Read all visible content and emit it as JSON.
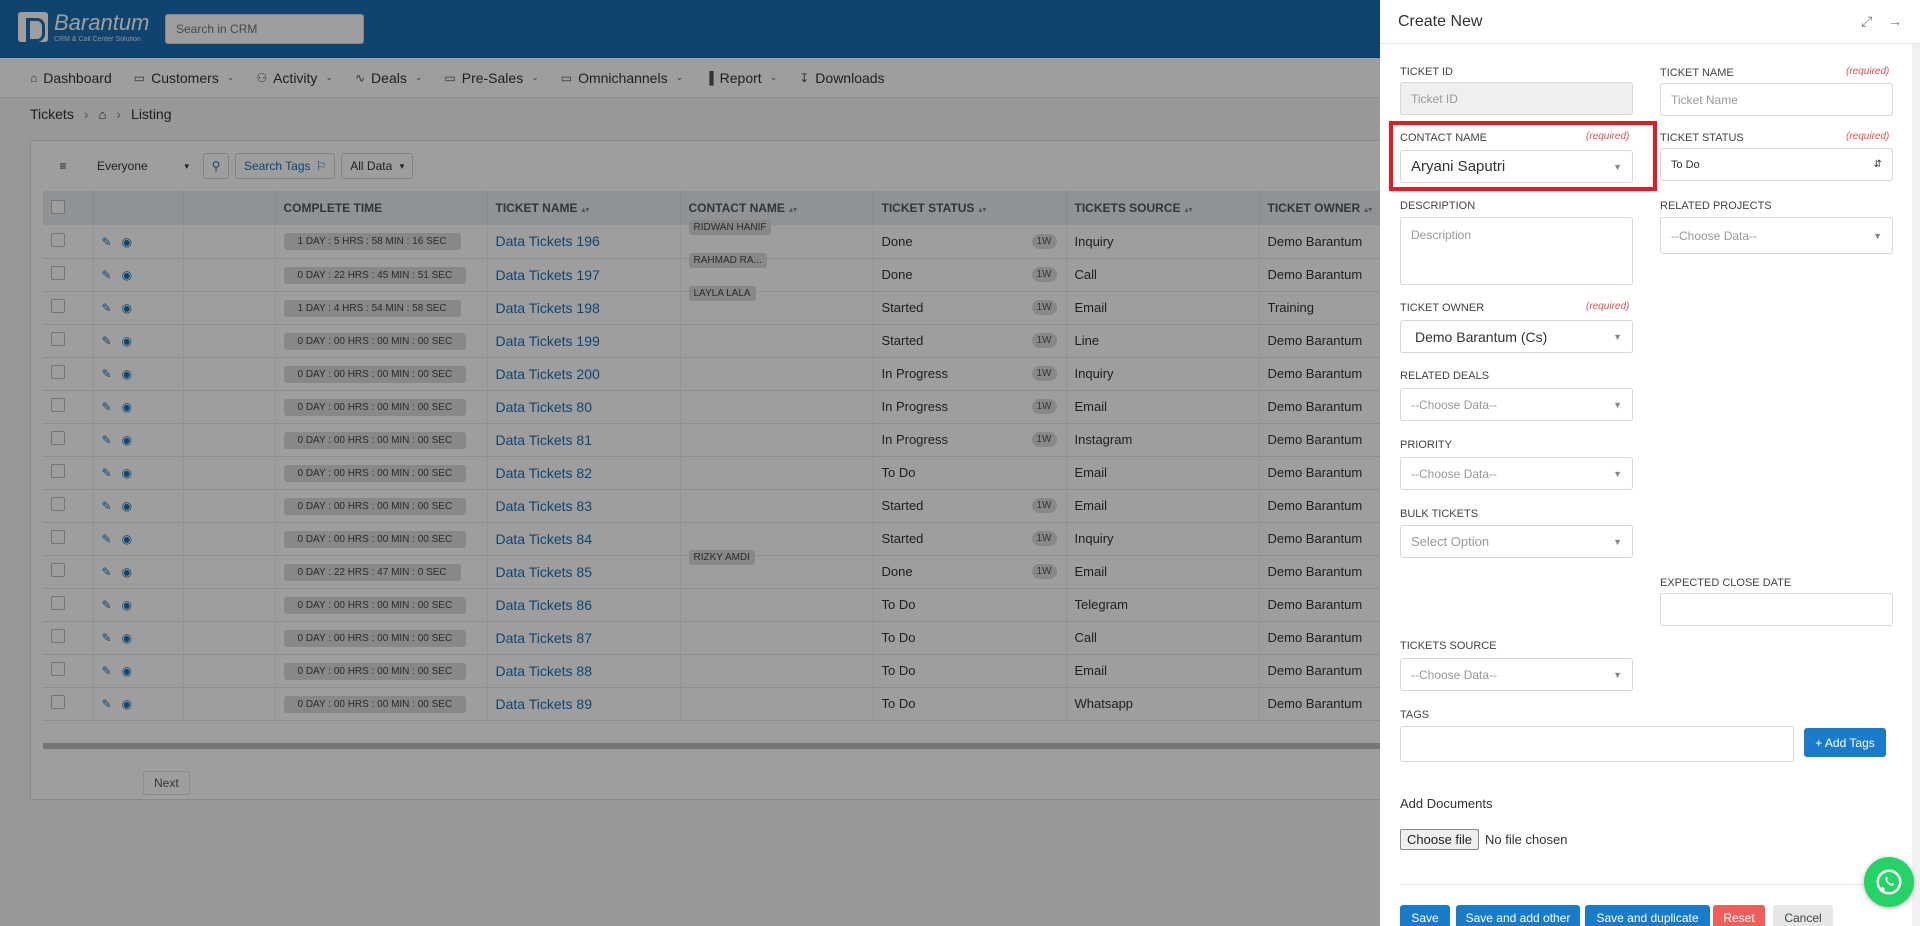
{
  "app": {
    "logo_name": "Barantum",
    "logo_sub": "CRM & Call Center Solution",
    "search_placeholder": "Search in CRM"
  },
  "nav": [
    {
      "label": "Dashboard",
      "icon": "home-icon",
      "chev": false
    },
    {
      "label": "Customers",
      "icon": "folder-icon",
      "chev": true
    },
    {
      "label": "Activity",
      "icon": "users-icon",
      "chev": true
    },
    {
      "label": "Deals",
      "icon": "pulse-icon",
      "chev": true
    },
    {
      "label": "Pre-Sales",
      "icon": "folder-icon",
      "chev": true
    },
    {
      "label": "Omnichannels",
      "icon": "folder-icon",
      "chev": true
    },
    {
      "label": "Report",
      "icon": "bar-chart-icon",
      "chev": true
    },
    {
      "label": "Downloads",
      "icon": "download-icon",
      "chev": false
    }
  ],
  "breadcrumb": {
    "section": "Tickets",
    "page": "Listing"
  },
  "toolbar": {
    "owner_filter": "Everyone",
    "search_tags": "Search Tags",
    "all_data": "All Data"
  },
  "table": {
    "headers": [
      "",
      "",
      "",
      "COMPLETE TIME",
      "TICKET NAME",
      "CONTACT NAME",
      "TICKET STATUS",
      "TICKETS SOURCE",
      "TICKET OWNER"
    ],
    "rows": [
      {
        "time": "1 DAY : 5 HRS : 58 MIN : 16 SEC",
        "name": "Data Tickets 196",
        "contact": "RIDWAN HANIF",
        "status": "Done",
        "badge": "1W",
        "source": "Inquiry",
        "owner": "Demo Barantum"
      },
      {
        "time": "0 DAY : 22 HRS : 45 MIN : 51 SEC",
        "name": "Data Tickets 197",
        "contact": "RAHMAD RA...",
        "status": "Done",
        "badge": "1W",
        "source": "Call",
        "owner": "Demo Barantum"
      },
      {
        "time": "1 DAY : 4 HRS : 54 MIN : 58 SEC",
        "name": "Data Tickets 198",
        "contact": "LAYLA LALA",
        "status": "Started",
        "badge": "1W",
        "source": "Email",
        "owner": "Training"
      },
      {
        "time": "0 DAY : 00 HRS : 00 MIN : 00 SEC",
        "name": "Data Tickets 199",
        "contact": "",
        "status": "Started",
        "badge": "1W",
        "source": "Line",
        "owner": "Demo Barantum"
      },
      {
        "time": "0 DAY : 00 HRS : 00 MIN : 00 SEC",
        "name": "Data Tickets 200",
        "contact": "",
        "status": "In Progress",
        "badge": "1W",
        "source": "Inquiry",
        "owner": "Demo Barantum"
      },
      {
        "time": "0 DAY : 00 HRS : 00 MIN : 00 SEC",
        "name": "Data Tickets 80",
        "contact": "",
        "status": "In Progress",
        "badge": "1W",
        "source": "Email",
        "owner": "Demo Barantum"
      },
      {
        "time": "0 DAY : 00 HRS : 00 MIN : 00 SEC",
        "name": "Data Tickets 81",
        "contact": "",
        "status": "In Progress",
        "badge": "1W",
        "source": "Instagram",
        "owner": "Demo Barantum"
      },
      {
        "time": "0 DAY : 00 HRS : 00 MIN : 00 SEC",
        "name": "Data Tickets 82",
        "contact": "",
        "status": "To Do",
        "badge": "",
        "source": "Email",
        "owner": "Demo Barantum"
      },
      {
        "time": "0 DAY : 00 HRS : 00 MIN : 00 SEC",
        "name": "Data Tickets 83",
        "contact": "",
        "status": "Started",
        "badge": "1W",
        "source": "Email",
        "owner": "Demo Barantum"
      },
      {
        "time": "0 DAY : 00 HRS : 00 MIN : 00 SEC",
        "name": "Data Tickets 84",
        "contact": "",
        "status": "Started",
        "badge": "1W",
        "source": "Inquiry",
        "owner": "Demo Barantum"
      },
      {
        "time": "0 DAY : 22 HRS : 47 MIN : 0 SEC",
        "name": "Data Tickets 85",
        "contact": "RIZKY AMDI",
        "status": "Done",
        "badge": "1W",
        "source": "Email",
        "owner": "Demo Barantum"
      },
      {
        "time": "0 DAY : 00 HRS : 00 MIN : 00 SEC",
        "name": "Data Tickets 86",
        "contact": "",
        "status": "To Do",
        "badge": "",
        "source": "Telegram",
        "owner": "Demo Barantum"
      },
      {
        "time": "0 DAY : 00 HRS : 00 MIN : 00 SEC",
        "name": "Data Tickets 87",
        "contact": "",
        "status": "To Do",
        "badge": "",
        "source": "Call",
        "owner": "Demo Barantum"
      },
      {
        "time": "0 DAY : 00 HRS : 00 MIN : 00 SEC",
        "name": "Data Tickets 88",
        "contact": "",
        "status": "To Do",
        "badge": "",
        "source": "Email",
        "owner": "Demo Barantum"
      },
      {
        "time": "0 DAY : 00 HRS : 00 MIN : 00 SEC",
        "name": "Data Tickets 89",
        "contact": "",
        "status": "To Do",
        "badge": "",
        "source": "Whatsapp",
        "owner": "Demo Barantum"
      }
    ]
  },
  "pager": {
    "next": "Next"
  },
  "panel": {
    "title": "Create New",
    "required": "(required)",
    "ticket_id": {
      "label": "TICKET ID",
      "placeholder": "Ticket ID"
    },
    "ticket_name": {
      "label": "TICKET NAME",
      "placeholder": "Ticket Name"
    },
    "contact_name": {
      "label": "CONTACT NAME",
      "value": "Aryani Saputri"
    },
    "ticket_status": {
      "label": "TICKET STATUS",
      "value": "To Do"
    },
    "description": {
      "label": "DESCRIPTION",
      "placeholder": "Description"
    },
    "related_projects": {
      "label": "RELATED PROJECTS",
      "placeholder": "--Choose Data--"
    },
    "ticket_owner": {
      "label": "TICKET OWNER",
      "value": "Demo Barantum (Cs)"
    },
    "related_deals": {
      "label": "RELATED DEALS",
      "placeholder": "--Choose Data--"
    },
    "priority": {
      "label": "PRIORITY",
      "placeholder": "--Choose Data--"
    },
    "bulk_tickets": {
      "label": "BULK TICKETS",
      "placeholder": "Select Option"
    },
    "expected_close_date": {
      "label": "EXPECTED CLOSE DATE"
    },
    "tickets_source": {
      "label": "TICKETS SOURCE",
      "placeholder": "--Choose Data--"
    },
    "tags": {
      "label": "TAGS",
      "add_button": "+ Add Tags"
    },
    "documents": {
      "title": "Add Documents",
      "choose": "Choose file",
      "none": "No file chosen"
    },
    "buttons": {
      "save": "Save",
      "save_add_other": "Save and add other",
      "save_duplicate": "Save and duplicate",
      "reset": "Reset",
      "cancel": "Cancel"
    }
  },
  "colors": {
    "brand": "#1a6fb3",
    "button_blue": "#1a7bc9",
    "required": "#e05050",
    "highlight": "#e31b23",
    "reset": "#ee5f5b",
    "whatsapp": "#25d366"
  }
}
